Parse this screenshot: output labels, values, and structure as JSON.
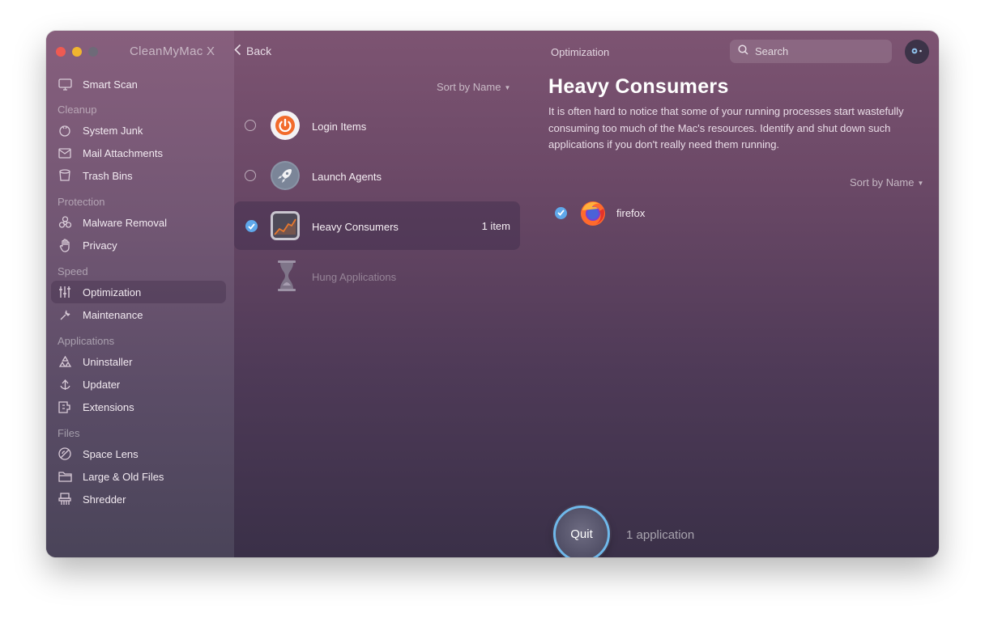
{
  "window": {
    "app_title": "CleanMyMac X",
    "back_label": "Back",
    "section_title": "Optimization",
    "search_placeholder": "Search"
  },
  "sidebar": {
    "smart_scan": "Smart Scan",
    "groups": {
      "cleanup": "Cleanup",
      "protection": "Protection",
      "speed": "Speed",
      "applications": "Applications",
      "files": "Files"
    },
    "items": {
      "system_junk": "System Junk",
      "mail_attachments": "Mail Attachments",
      "trash_bins": "Trash Bins",
      "malware_removal": "Malware Removal",
      "privacy": "Privacy",
      "optimization": "Optimization",
      "maintenance": "Maintenance",
      "uninstaller": "Uninstaller",
      "updater": "Updater",
      "extensions": "Extensions",
      "space_lens": "Space Lens",
      "large_old_files": "Large & Old Files",
      "shredder": "Shredder"
    },
    "active_item": "optimization"
  },
  "middle": {
    "sort_label": "Sort by Name",
    "rows": [
      {
        "label": "Login Items",
        "count": "",
        "checked": false
      },
      {
        "label": "Launch Agents",
        "count": "",
        "checked": false
      },
      {
        "label": "Heavy Consumers",
        "count": "1 item",
        "checked": true
      },
      {
        "label": "Hung Applications",
        "count": "",
        "checked": false,
        "disabled": true
      }
    ]
  },
  "detail": {
    "title": "Heavy Consumers",
    "description": "It is often hard to notice that some of your running processes start wastefully consuming too much of the Mac's resources. Identify and shut down such applications if you don't really need them running.",
    "sort_label": "Sort by Name",
    "apps": [
      {
        "name": "firefox",
        "checked": true,
        "icon": "firefox-icon"
      }
    ]
  },
  "action": {
    "quit_label": "Quit",
    "count_label": "1 application"
  },
  "colors": {
    "accent": "#5fa8ea",
    "quit_ring": "#6fb8ea",
    "traffic_red": "#ee5a52",
    "traffic_yellow": "#f0b52f",
    "traffic_inactive": "#6e6a78"
  }
}
